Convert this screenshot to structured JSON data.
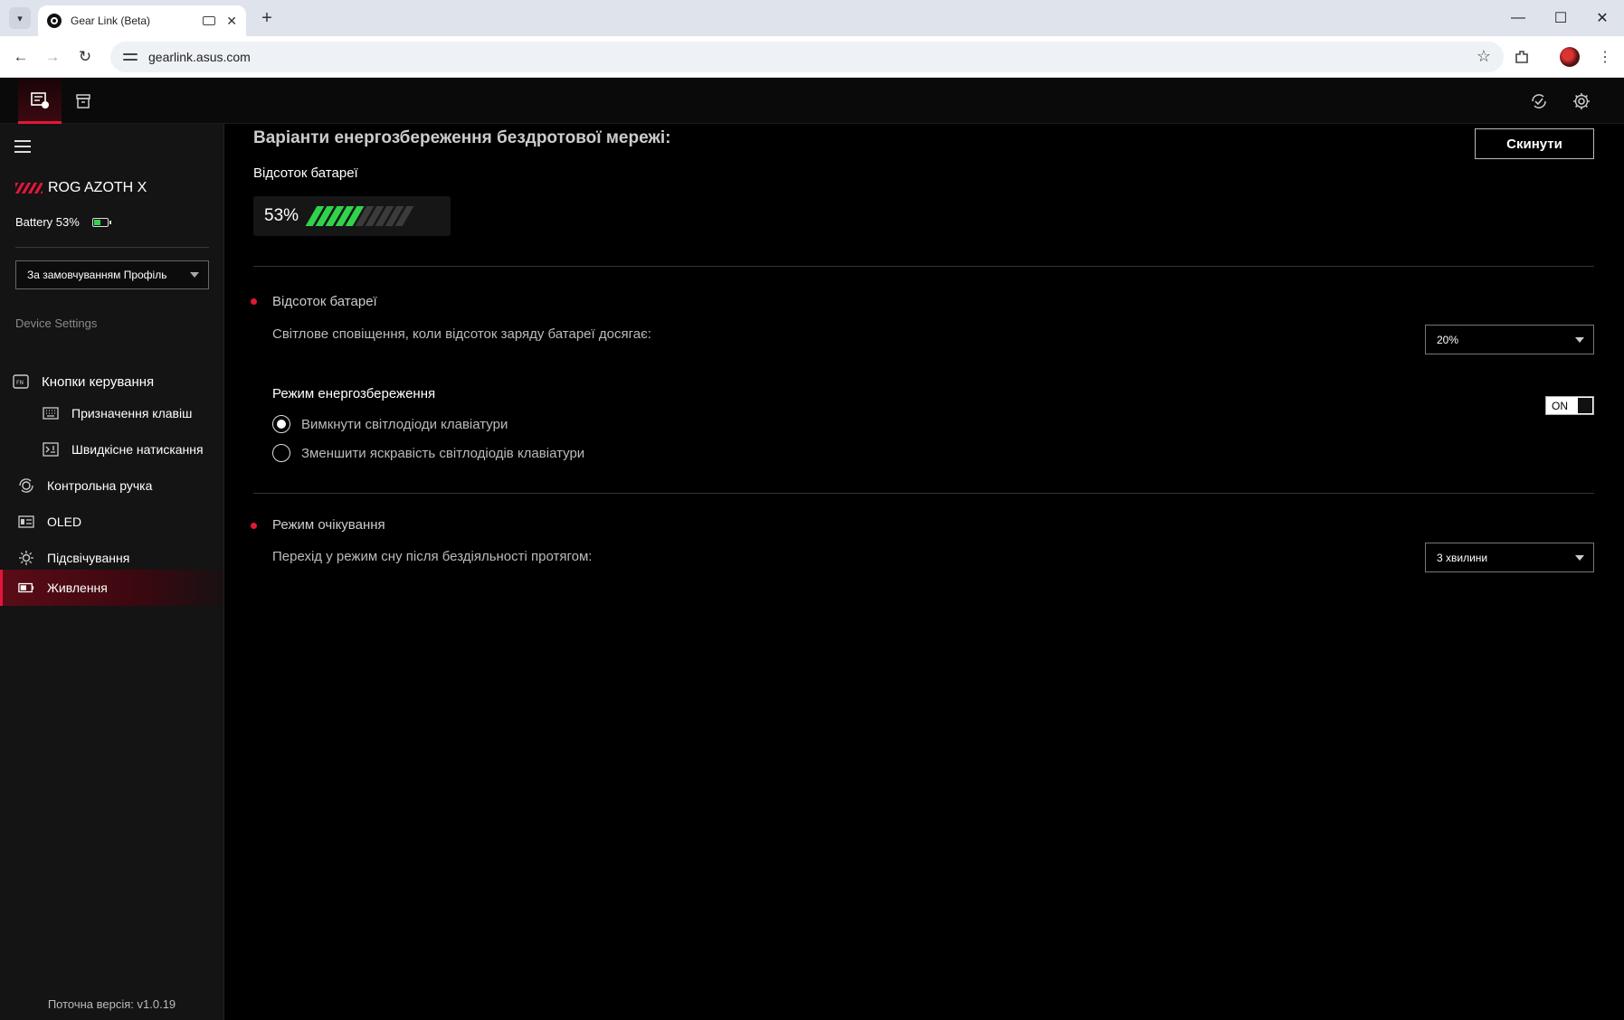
{
  "browser": {
    "tab_title": "Gear Link (Beta)",
    "url": "gearlink.asus.com"
  },
  "sidebar": {
    "device_name": "ROG AZOTH X",
    "battery_text": "Battery 53%",
    "battery_level": 0.53,
    "profile_value": "За замовчуванням Профіль",
    "section_label": "Device Settings",
    "items": [
      {
        "label": "Кнопки керування",
        "icon": "fn-key-icon"
      },
      {
        "label": "Призначення клавіш",
        "icon": "keyboard-icon"
      },
      {
        "label": "Швидкісне натискання",
        "icon": "rapid-trigger-icon"
      },
      {
        "label": "Контрольна ручка",
        "icon": "control-knob-icon"
      },
      {
        "label": "OLED",
        "icon": "oled-icon"
      },
      {
        "label": "Підсвічування",
        "icon": "lighting-icon"
      },
      {
        "label": "Живлення",
        "icon": "power-icon",
        "active": true
      }
    ],
    "version": "Поточна версія: v1.0.19"
  },
  "main": {
    "title": "Варіанти енергозбереження бездротової мережі:",
    "reset_label": "Скинути",
    "battery_label": "Відсоток батареї",
    "battery_percent_text": "53%",
    "battery_segments_total": 10,
    "battery_segments_filled": 5,
    "battery_section": {
      "title": "Відсоток батареї",
      "notify_text": "Світлове сповіщення, коли відсоток заряду батареї досягає:",
      "notify_value": "20%"
    },
    "power_saving": {
      "title": "Режим енергозбереження",
      "toggle_label": "ON",
      "options": [
        "Вимкнути світлодіоди клавіатури",
        "Зменшити яскравість світлодіодів клавіатури"
      ],
      "selected_index": 0
    },
    "standby": {
      "title": "Режим очікування",
      "sleep_text": "Перехід у режим сну після бездіяльності протягом:",
      "sleep_value": "3 хвилини"
    }
  },
  "colors": {
    "accent": "#e3163a",
    "battery_green": "#30d44a"
  }
}
